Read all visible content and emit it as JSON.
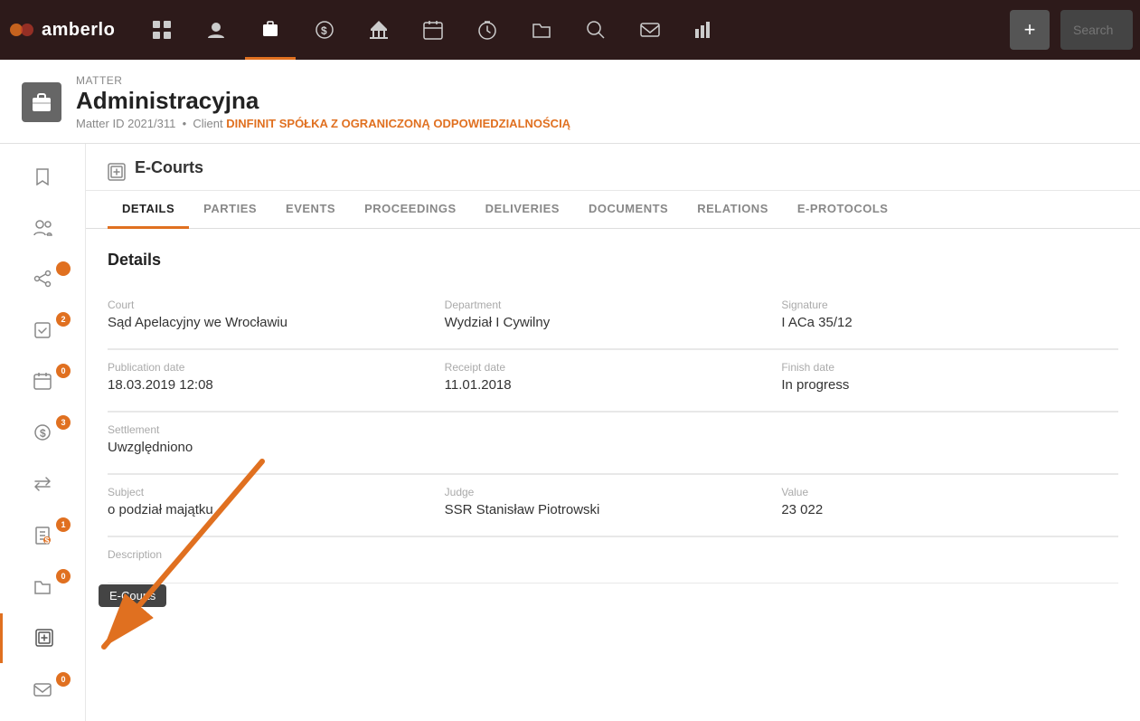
{
  "app": {
    "name": "amberlo"
  },
  "nav": {
    "items": [
      {
        "id": "dashboard",
        "icon": "⊞",
        "active": false
      },
      {
        "id": "contacts",
        "icon": "👤",
        "active": false
      },
      {
        "id": "matters",
        "icon": "💼",
        "active": true
      },
      {
        "id": "billing",
        "icon": "＄",
        "active": false
      },
      {
        "id": "bank",
        "icon": "🏛",
        "active": false
      },
      {
        "id": "calendar",
        "icon": "📅",
        "active": false
      },
      {
        "id": "timer",
        "icon": "⏱",
        "active": false
      },
      {
        "id": "documents",
        "icon": "📁",
        "active": false
      },
      {
        "id": "reports2",
        "icon": "🔍",
        "active": false
      },
      {
        "id": "email",
        "icon": "✉",
        "active": false
      },
      {
        "id": "analytics",
        "icon": "📊",
        "active": false
      }
    ],
    "add_label": "+",
    "search_placeholder": "Search"
  },
  "matter": {
    "label": "Matter",
    "title": "Administracyjna",
    "id_label": "Matter ID",
    "id_value": "2021/311",
    "client_label": "Client",
    "client_name": "DINFINIT SPÓŁKA Z OGRANICZONĄ ODPOWIEDZIALNOŚCIĄ"
  },
  "sidebar": {
    "items": [
      {
        "id": "bookmark",
        "icon": "🔖",
        "badge": null,
        "active": false
      },
      {
        "id": "people",
        "icon": "👥",
        "badge": null,
        "active": false
      },
      {
        "id": "share",
        "icon": "↗",
        "badge": null,
        "active": false
      },
      {
        "id": "checklist",
        "icon": "✓",
        "badge": "2",
        "active": false
      },
      {
        "id": "calendar2",
        "icon": "📆",
        "badge": "0",
        "active": false
      },
      {
        "id": "money",
        "icon": "💲",
        "badge": "3",
        "active": false
      },
      {
        "id": "transfer",
        "icon": "⇄",
        "badge": null,
        "active": false
      },
      {
        "id": "billing2",
        "icon": "💲",
        "badge": "1",
        "active": false
      },
      {
        "id": "folder",
        "icon": "📂",
        "badge": "0",
        "active": false
      },
      {
        "id": "ecourts",
        "icon": "⊡",
        "badge": null,
        "active": true,
        "tooltip": "E-Courts"
      },
      {
        "id": "email2",
        "icon": "✉",
        "badge": "0",
        "active": false
      }
    ]
  },
  "ecourts": {
    "section_icon": "⊟",
    "section_title": "E-Courts",
    "tabs": [
      {
        "id": "details",
        "label": "DETAILS",
        "active": true
      },
      {
        "id": "parties",
        "label": "PARTIES",
        "active": false
      },
      {
        "id": "events",
        "label": "EVENTS",
        "active": false
      },
      {
        "id": "proceedings",
        "label": "PROCEEDINGS",
        "active": false
      },
      {
        "id": "deliveries",
        "label": "DELIVERIES",
        "active": false
      },
      {
        "id": "documents",
        "label": "DOCUMENTS",
        "active": false
      },
      {
        "id": "relations",
        "label": "RELATIONS",
        "active": false
      },
      {
        "id": "eprotocols",
        "label": "E-PROTOCOLS",
        "active": false
      }
    ],
    "details_title": "Details",
    "fields": {
      "court_label": "Court",
      "court_value": "Sąd Apelacyjny we Wrocławiu",
      "department_label": "Department",
      "department_value": "Wydział I Cywilny",
      "signature_label": "Signature",
      "signature_value": "I ACa 35/12",
      "publication_date_label": "Publication date",
      "publication_date_value": "18.03.2019 12:08",
      "receipt_date_label": "Receipt date",
      "receipt_date_value": "11.01.2018",
      "finish_date_label": "Finish date",
      "finish_date_value": "In progress",
      "settlement_label": "Settlement",
      "settlement_value": "Uwzględniono",
      "subject_label": "Subject",
      "subject_value": "o podział majątku",
      "judge_label": "Judge",
      "judge_value": "SSR Stanisław Piotrowski",
      "value_label": "Value",
      "value_value": "23 022",
      "description_label": "Description",
      "description_value": ""
    }
  },
  "tooltip": {
    "ecourts_label": "E-Courts"
  }
}
